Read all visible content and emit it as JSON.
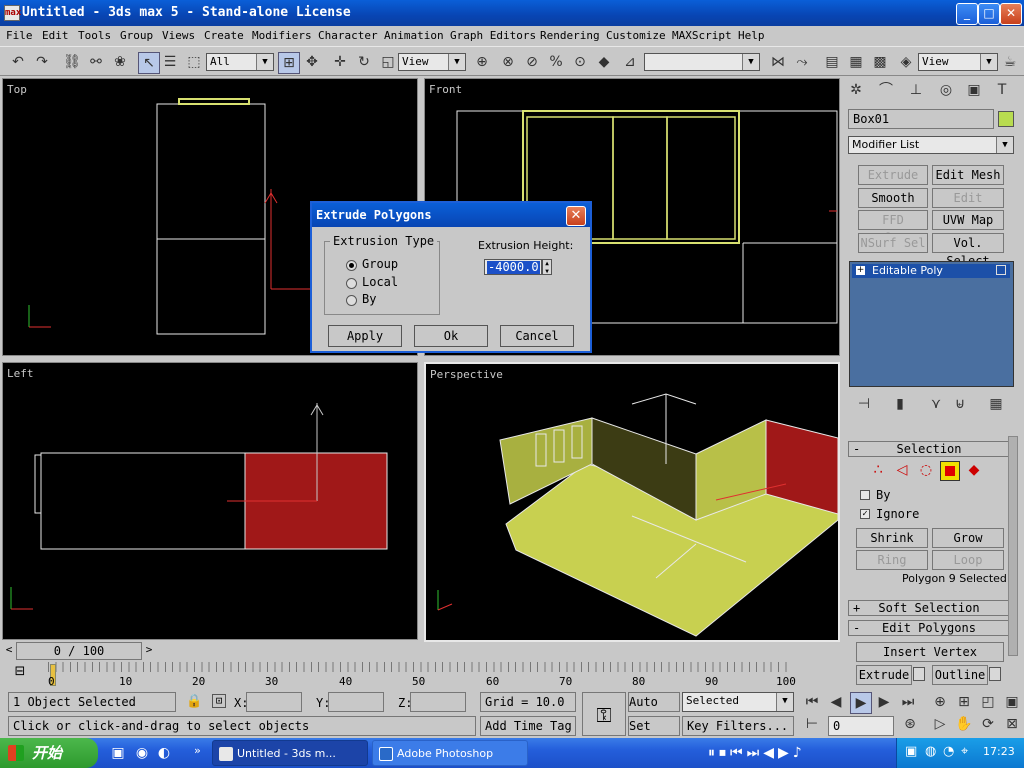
{
  "window": {
    "title": "Untitled - 3ds max 5 - Stand-alone License",
    "app_icon": "max",
    "min": "_",
    "max": "□",
    "close": "✕"
  },
  "menu": [
    "File",
    "Edit",
    "Tools",
    "Group",
    "Views",
    "Create",
    "Modifiers",
    "Character",
    "Animation",
    "Graph Editors",
    "Rendering",
    "Customize",
    "MAXScript",
    "Help"
  ],
  "toolbar": {
    "selection_filter": "All",
    "ref_coord": "View",
    "named_sel": "",
    "ref_coord2": "View"
  },
  "viewports": {
    "top": "Top",
    "front": "Front",
    "left": "Left",
    "perspective": "Perspective"
  },
  "dialog": {
    "title": "Extrude Polygons",
    "group_label": "Extrusion Type",
    "options": [
      "Group",
      "Local",
      "By"
    ],
    "selected": "Group",
    "height_label": "Extrusion Height:",
    "height_value": "-4000.0",
    "apply": "Apply",
    "ok": "Ok",
    "cancel": "Cancel",
    "close": "✕"
  },
  "panel": {
    "object_name": "Box01",
    "object_color": "#b8dc50",
    "modifier_list": "Modifier List",
    "buttons": [
      {
        "label": "Extrude",
        "enabled": false
      },
      {
        "label": "Edit Mesh",
        "enabled": true
      },
      {
        "label": "Smooth",
        "enabled": true
      },
      {
        "label": "Edit Spline",
        "enabled": false
      },
      {
        "label": "FFD Select",
        "enabled": false
      },
      {
        "label": "UVW Map",
        "enabled": true
      },
      {
        "label": "NSurf Sel",
        "enabled": false
      },
      {
        "label": "Vol. Select",
        "enabled": true
      }
    ],
    "stack_item": "Editable Poly",
    "selection_rollout": "Selection",
    "by_label": "By",
    "ignore_label": "Ignore",
    "shrink": "Shrink",
    "grow": "Grow",
    "ring": "Ring",
    "loop": "Loop",
    "sel_status": "Polygon 9 Selected",
    "soft_selection": "Soft Selection",
    "edit_polygons": "Edit Polygons",
    "insert_vertex": "Insert Vertex",
    "extrude": "Extrude",
    "outline": "Outline",
    "minus": "-",
    "plus": "+"
  },
  "timeline": {
    "frame": "0 / 100",
    "ticks": [
      "0",
      "10",
      "20",
      "30",
      "40",
      "50",
      "60",
      "70",
      "80",
      "90",
      "100"
    ]
  },
  "status": {
    "selected": "1 Object Selected",
    "prompt": "Click or click-and-drag to select objects",
    "x_label": "X:",
    "y_label": "Y:",
    "z_label": "Z:",
    "grid": "Grid = 10.0",
    "add_time_tag": "Add Time Tag",
    "auto_key": "Auto Key",
    "set_key": "Set Key",
    "key_mode": "Selected",
    "key_filters": "Key Filters...",
    "frame_field": "0"
  },
  "taskbar": {
    "start": "开始",
    "tasks": [
      "Untitled - 3ds m...",
      "Adobe Photoshop"
    ],
    "time": "17:23"
  },
  "colors": {
    "poly_green": "#d8e070",
    "selected_red": "#c02020",
    "titlebar": "#0a5fd8"
  }
}
